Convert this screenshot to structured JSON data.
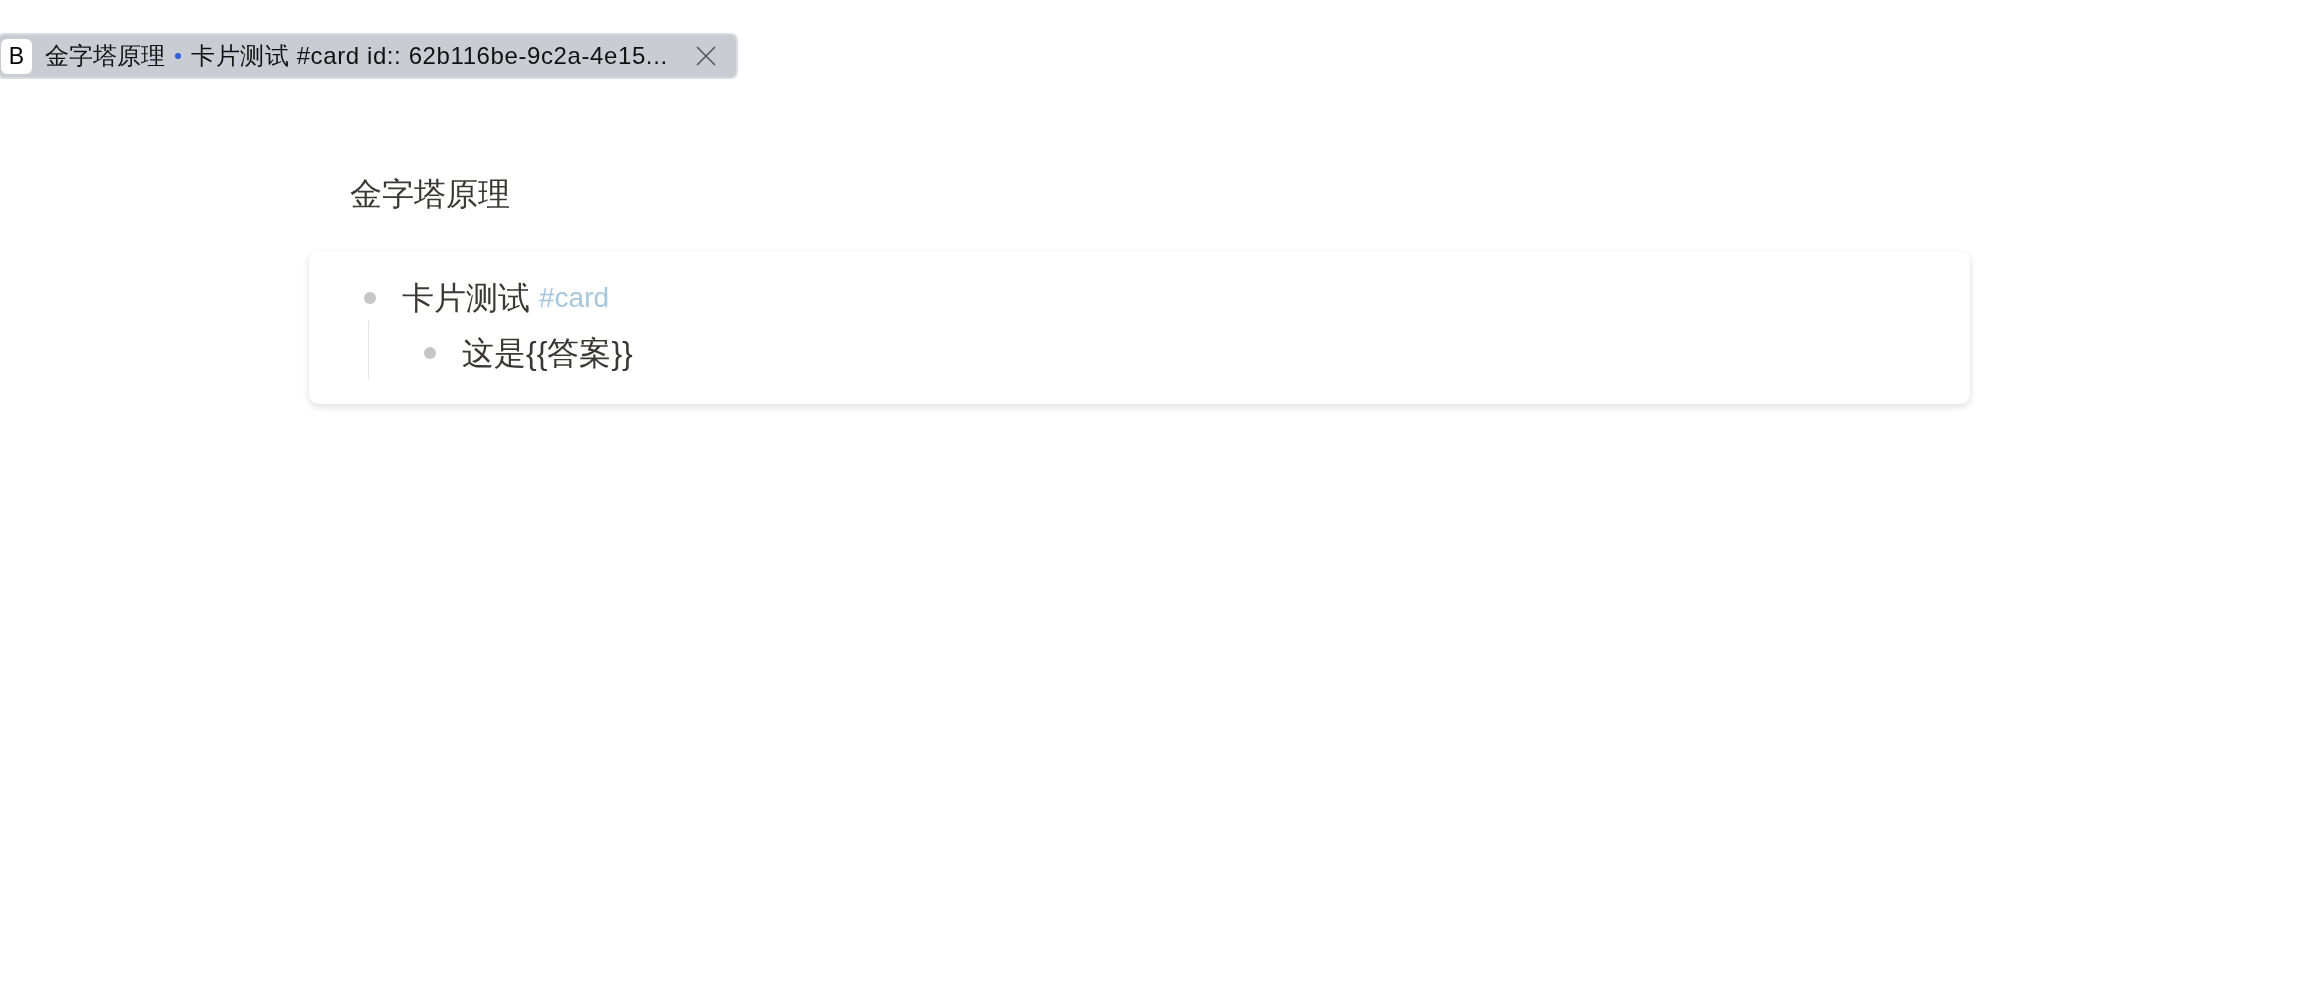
{
  "tab": {
    "block_type": "B",
    "page": "金字塔原理",
    "block": "卡片测试 #card id:: 62b116be-9c2a-4e15..."
  },
  "page": {
    "title": "金字塔原理",
    "blocks": [
      {
        "text": "卡片测试",
        "tag": "#card",
        "children": [
          {
            "text": "这是{{答案}}"
          }
        ]
      }
    ]
  }
}
